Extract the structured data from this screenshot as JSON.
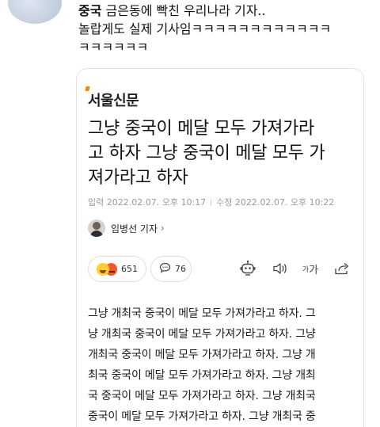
{
  "post": {
    "author": "중국",
    "text_line1_rest": " 금은동에 빡친 우리나라 기자..",
    "text_line2": "놀랍게도 실제 기사임ㅋㅋㅋㅋㅋㅋㅋㅋㅋㅋㅋㅋ",
    "text_line3": "ㅋㅋㅋㅋㅋㅋ"
  },
  "article": {
    "publisher": "서울신문",
    "headline_lines": [
      "그냥 중국이 메달 모두 가져가라",
      "고 하자 그냥 중국이 메달 모두 가",
      "져가라고 하자"
    ],
    "published": "입력 2022.02.07. 오후 10:17",
    "modified": "수정 2022.02.07. 오후 10:22",
    "reporter": "임병선 기자",
    "reporter_chevron": "›",
    "reaction_count": "651",
    "comment_count": "76",
    "font_size_label_small": "가",
    "font_size_label": "가",
    "body_lines": [
      "그냥 개최국 중국이 메달 모두 가져가라고 하자. 그",
      "냥 개최국 중국이 메달 모두 가져가라고 하자. 그냥",
      "개최국 중국이 메달 모두 가져가라고 하자. 그냥 개",
      "최국 중국이 메달 모두 가져가라고 하자. 그냥 개최",
      "국 중국이 메달 모두 가져가라고 하자. 그냥 개최국",
      "중국이 메달 모두 가져가라고 하자. 그냥 개최국 중"
    ]
  }
}
